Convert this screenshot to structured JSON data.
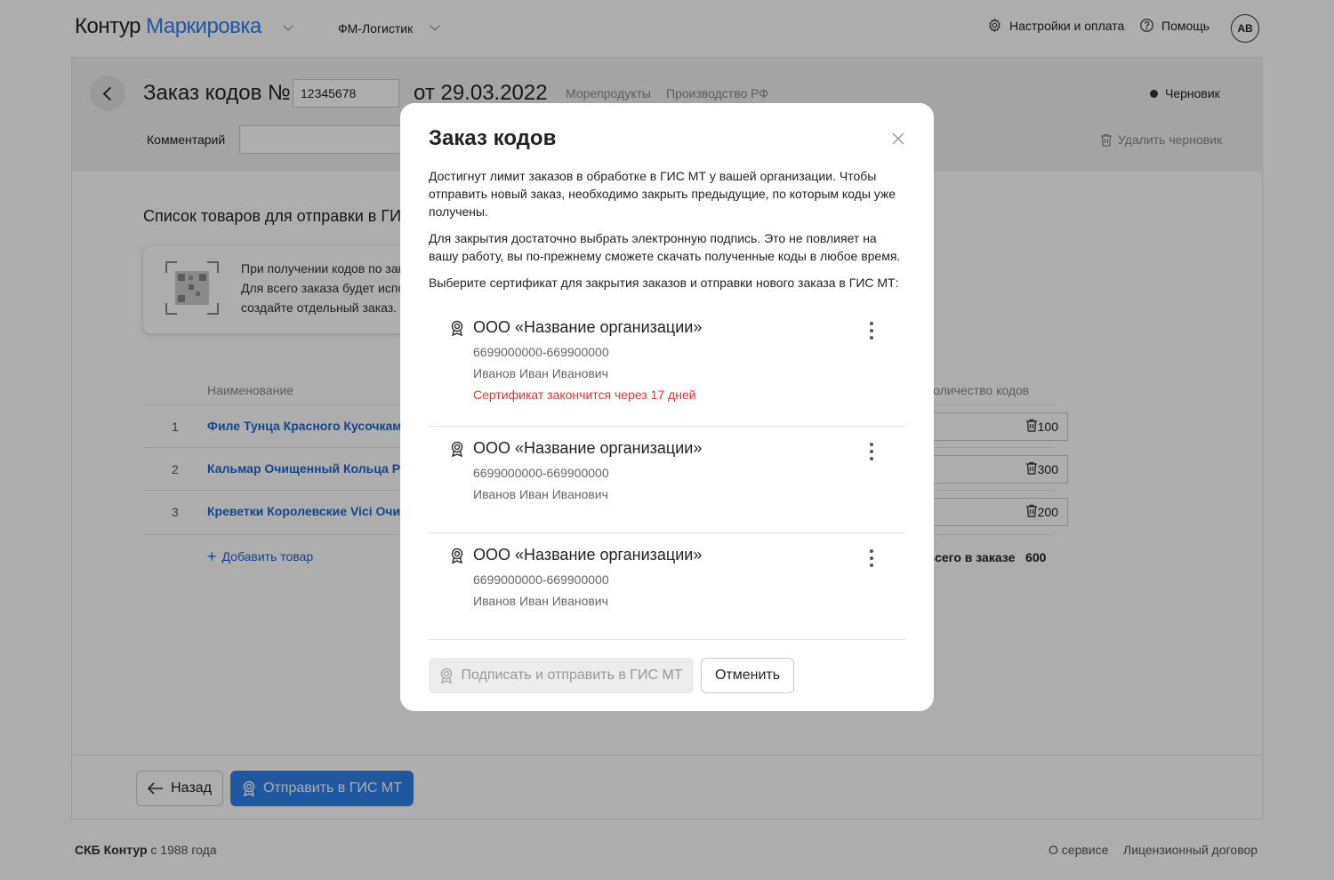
{
  "header": {
    "logo_primary": "Контур",
    "logo_secondary": "Маркировка",
    "org_name": "ФМ-Логистик",
    "settings_label": "Настройки и оплата",
    "help_label": "Помощь",
    "avatar_initials": "АВ"
  },
  "order": {
    "title": "Заказ кодов №",
    "number": "12345678",
    "date": "от 29.03.2022",
    "tags": [
      "Морепродукты",
      "Производство РФ"
    ],
    "status": "Черновик",
    "comment_label": "Комментарий",
    "comment_value": "",
    "delete_draft_label": "Удалить черновик"
  },
  "products": {
    "list_title": "Список товаров для отправки в ГИС МТ",
    "info_text": [
      "При получении кодов по заказу",
      "Для всего заказа будет использ",
      "создайте отдельный заказ."
    ],
    "columns": {
      "name": "Наименование",
      "count": "Количество кодов"
    },
    "rows": [
      {
        "num": "1",
        "name": "Филе Тунца Красного Кусочками",
        "qty": "100"
      },
      {
        "num": "2",
        "name": "Кальмар Очищенный Кольца Рыбный",
        "qty": "300"
      },
      {
        "num": "3",
        "name": "Креветки Королевские Vici Очищенные",
        "qty": "200"
      }
    ],
    "add_label": "Добавить товар",
    "total_label": "Всего в заказе",
    "total_value": "600"
  },
  "footer_actions": {
    "back_label": "Назад",
    "send_label": "Отправить в ГИС МТ"
  },
  "footer": {
    "company": "СКБ Контур",
    "since": " с 1988 года",
    "about_label": "О сервисе",
    "license_label": "Лицензионный договор"
  },
  "modal": {
    "title": "Заказ кодов",
    "paragraph1": "Достигнут лимит заказов в обработке в ГИС МТ у вашей организации. Чтобы отправить новый заказ, необходимо закрыть предыдущие, по которым коды уже получены.",
    "paragraph2": "Для закрытия достаточно выбрать электронную подпись. Это не повлияет на вашу работу, вы по-прежнему сможете скачать полученные коды в любое время.",
    "paragraph3": "Выберите сертификат для закрытия заказов и отправки нового заказа в ГИС МТ:",
    "certificates": [
      {
        "org": "ООО «Название организации»",
        "inn": "6699000000-669900000",
        "person": "Иванов Иван Иванович",
        "warning": "Сертификат закончится через 17 дней"
      },
      {
        "org": "ООО «Название организации»",
        "inn": "6699000000-669900000",
        "person": "Иванов Иван Иванович",
        "warning": ""
      },
      {
        "org": "ООО «Название организации»",
        "inn": "6699000000-669900000",
        "person": "Иванов Иван Иванович",
        "warning": ""
      }
    ],
    "sign_label": "Подписать и отправить в ГИС МТ",
    "cancel_label": "Отменить"
  },
  "colors": {
    "accent": "#2f80ed",
    "link": "#1f67c9",
    "warning": "#dd3333"
  }
}
